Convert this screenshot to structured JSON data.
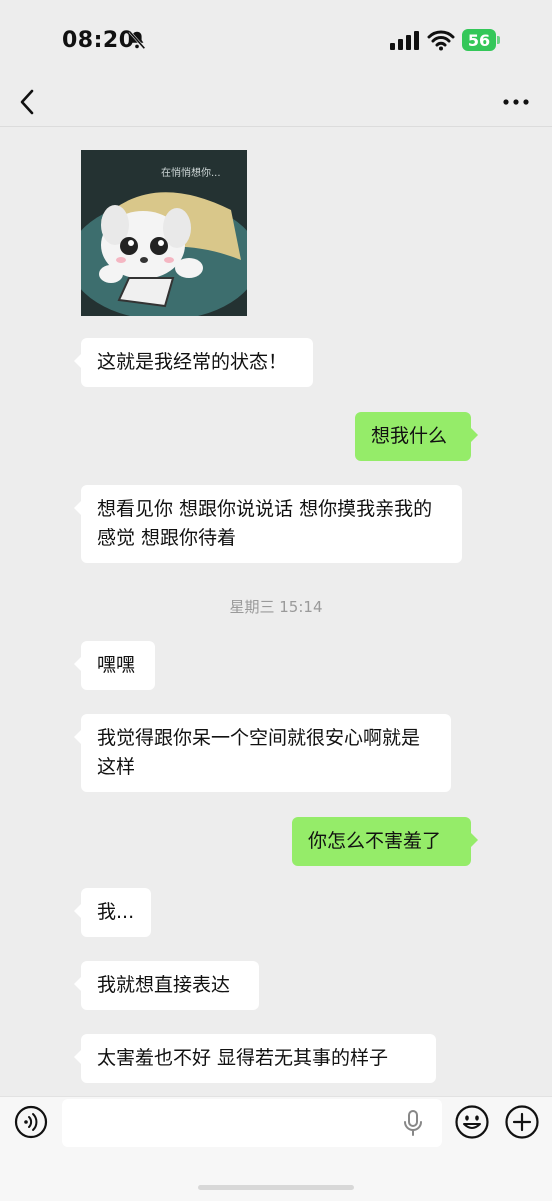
{
  "status_bar": {
    "time": "08:20",
    "battery": "56"
  },
  "sticker": {
    "caption": "在悄悄想你..."
  },
  "messages": [
    {
      "side": "left",
      "text": "这就是我经常的状态！"
    },
    {
      "side": "right",
      "text": "想我什么"
    },
    {
      "side": "left",
      "text": "想看见你 想跟你说说话 想你摸我亲我的感觉 想跟你待着"
    },
    {
      "side": "left",
      "text": "嘿嘿"
    },
    {
      "side": "left",
      "text": "我觉得跟你呆一个空间就很安心啊就是这样"
    },
    {
      "side": "right",
      "text": "你怎么不害羞了"
    },
    {
      "side": "left",
      "text": "我..."
    },
    {
      "side": "left",
      "text": "我就想直接表达"
    },
    {
      "side": "left",
      "text": "太害羞也不好 显得若无其事的样子"
    }
  ],
  "timestamp": "星期三 15:14",
  "input": {
    "value": "",
    "placeholder": ""
  },
  "icons": {
    "back": "chevron-left-icon",
    "more": "more-dots-icon",
    "voice": "voice-icon",
    "mic": "microphone-icon",
    "emoji": "emoji-icon",
    "plus": "plus-icon"
  },
  "colors": {
    "background": "#ededed",
    "bubble_self": "#95ec69",
    "bubble_other": "#ffffff",
    "battery": "#34c759"
  }
}
